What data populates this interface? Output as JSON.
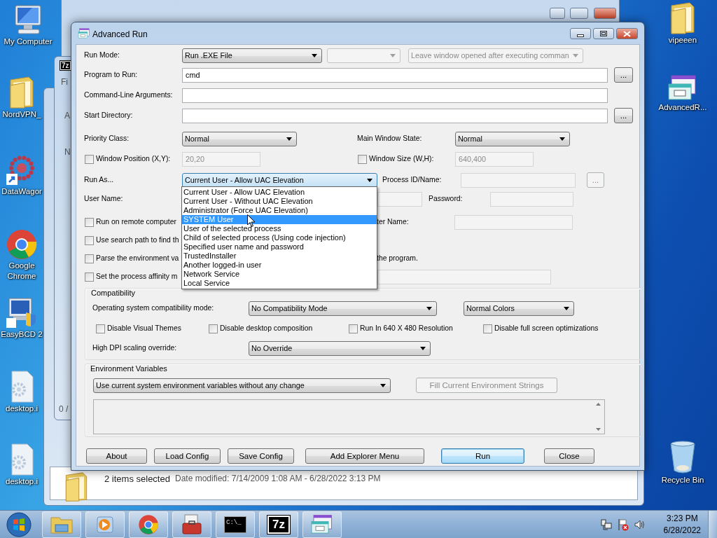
{
  "desktop_icons_left": [
    {
      "kind": "computer",
      "label": "My Computer"
    },
    {
      "kind": "folder",
      "label": "NordVPN_"
    },
    {
      "kind": "dots",
      "label": "DataWagor"
    },
    {
      "kind": "chrome",
      "label": "Google Chrome"
    },
    {
      "kind": "easybcd",
      "label": "EasyBCD 2"
    },
    {
      "kind": "gearfile",
      "label": "desktop.i"
    },
    {
      "kind": "gearfile",
      "label": "desktop.i"
    }
  ],
  "desktop_icons_right": [
    {
      "kind": "folder",
      "label": "vipeeen"
    },
    {
      "kind": "appwin",
      "label": "AdvancedR..."
    },
    {
      "kind": "recycle",
      "label": "Recycle Bin"
    }
  ],
  "back_window_7z": {
    "icon_text": "7z",
    "texts": [
      "Fi",
      "A",
      "N",
      "0 /"
    ]
  },
  "explorer_window": {
    "selection": "2 items selected",
    "date_modified": "Date modified: 7/14/2009 1:08 AM - 6/28/2022 3:13 PM"
  },
  "dialog": {
    "title": "Advanced Run",
    "rows": [
      [
        {
          "kind": "label",
          "text": "Run Mode:"
        },
        {
          "kind": "combo",
          "value": "Run .EXE File",
          "disabled": false,
          "focused": false
        },
        {
          "kind": "combo",
          "disabled": true,
          "focused": false
        },
        {
          "kind": "combo",
          "value": "Leave window opened after executing comman",
          "disabled": true,
          "focused": false
        }
      ],
      [
        {
          "kind": "label",
          "text": "Program to Run:"
        },
        {
          "kind": "input",
          "value": "cmd",
          "disabled": false
        },
        {
          "kind": "button",
          "text": "...",
          "disabled": false
        }
      ],
      [
        {
          "kind": "label",
          "text": "Command-Line Arguments:"
        },
        {
          "kind": "input",
          "disabled": false
        }
      ],
      [
        {
          "kind": "label",
          "text": "Start Directory:"
        },
        {
          "kind": "input",
          "disabled": false
        },
        {
          "kind": "button",
          "text": "...",
          "disabled": false
        }
      ],
      [
        {
          "kind": "label",
          "text": "Priority Class:"
        },
        {
          "kind": "combo",
          "value": "Normal",
          "disabled": false,
          "focused": false
        },
        {
          "kind": "label",
          "text": "Main Window State:"
        },
        {
          "kind": "combo",
          "value": "Normal",
          "disabled": false,
          "focused": false
        }
      ],
      [
        {
          "kind": "check",
          "text": "Window Position (X,Y):",
          "checked": false
        },
        {
          "kind": "input",
          "value": "20,20",
          "disabled": true
        },
        {
          "kind": "check",
          "text": "Window Size (W,H):",
          "checked": false
        },
        {
          "kind": "input",
          "value": "640,400",
          "disabled": true
        }
      ],
      [
        {
          "kind": "label",
          "text": "Run As..."
        },
        {
          "kind": "combo",
          "value": "Current User - Allow UAC Elevation",
          "disabled": false,
          "focused": true
        },
        {
          "kind": "label",
          "text": "Process ID/Name:"
        },
        {
          "kind": "input",
          "disabled": true
        },
        {
          "kind": "button",
          "text": "...",
          "disabled": true
        }
      ],
      [
        {
          "kind": "label",
          "text": "User Name:"
        },
        {
          "kind": "input",
          "disabled": true
        },
        {
          "kind": "label",
          "text": "Password:"
        },
        {
          "kind": "input",
          "disabled": true
        }
      ],
      [
        {
          "kind": "check",
          "text": "Run on remote computer",
          "checked": false
        },
        {
          "kind": "label",
          "text": "ter Name:"
        },
        {
          "kind": "input",
          "disabled": true
        }
      ],
      [
        {
          "kind": "check",
          "text": "Use search path to find th",
          "checked": false
        }
      ],
      [
        {
          "kind": "check",
          "text": "Parse the environment va",
          "checked": false
        },
        {
          "kind": "label",
          "text": "the program."
        }
      ],
      [
        {
          "kind": "check",
          "text": "Set the process affinity m",
          "checked": false
        },
        {
          "kind": "input",
          "disabled": true
        }
      ]
    ],
    "run_as_list": [
      {
        "label": "Current User - Allow UAC Elevation",
        "selected": false
      },
      {
        "label": "Current User - Without UAC Elevation",
        "selected": false
      },
      {
        "label": "Administrator (Force UAC Elevation)",
        "selected": false
      },
      {
        "label": "SYSTEM User",
        "selected": true
      },
      {
        "label": "User of the selected process",
        "selected": false
      },
      {
        "label": "Child of selected process (Using code injection)",
        "selected": false
      },
      {
        "label": "Specified user name and password",
        "selected": false
      },
      {
        "label": "TrustedInstaller",
        "selected": false
      },
      {
        "label": "Another logged-in user",
        "selected": false
      },
      {
        "label": "Network Service",
        "selected": false
      },
      {
        "label": "Local Service",
        "selected": false
      }
    ],
    "compatibility": {
      "legend": "Compatibility",
      "rows": [
        [
          {
            "kind": "label",
            "text": "Operating system compatibility mode:"
          },
          {
            "kind": "combo",
            "value": "No Compatibility Mode",
            "disabled": false,
            "focused": false
          },
          {
            "kind": "combo",
            "value": "Normal Colors",
            "disabled": false,
            "focused": false
          }
        ],
        [
          {
            "kind": "check",
            "text": "Disable Visual Themes",
            "checked": false
          },
          {
            "kind": "check",
            "text": "Disable desktop composition",
            "checked": false
          },
          {
            "kind": "check",
            "text": "Run In 640 X 480 Resolution",
            "checked": false
          },
          {
            "kind": "check",
            "text": "Disable full screen optimizations",
            "checked": false
          }
        ],
        [
          {
            "kind": "label",
            "text": "High DPI scaling override:"
          },
          {
            "kind": "combo",
            "value": "No Override",
            "disabled": false,
            "focused": false
          }
        ]
      ]
    },
    "environment": {
      "legend": "Environment Variables",
      "rows": [
        [
          {
            "kind": "combo",
            "value": "Use current system environment variables without any change",
            "disabled": false,
            "focused": false
          },
          {
            "kind": "button",
            "text": "Fill Current Environment Strings",
            "disabled": true
          }
        ],
        [
          {
            "kind": "textarea"
          }
        ]
      ]
    },
    "buttons": [
      {
        "label": "About",
        "default": false
      },
      {
        "label": "Load Config",
        "default": false
      },
      {
        "label": "Save Config",
        "default": false
      },
      {
        "label": "Add Explorer Menu",
        "default": false
      },
      {
        "label": "Run",
        "default": true
      },
      {
        "label": "Close",
        "default": false
      }
    ]
  },
  "taskbar": {
    "items": [
      {
        "kind": "explorer"
      },
      {
        "kind": "media"
      },
      {
        "kind": "chrome"
      },
      {
        "kind": "toolbox"
      },
      {
        "kind": "cmd",
        "text": "C:\\_"
      },
      {
        "kind": "sevenzip",
        "text": "7z"
      },
      {
        "kind": "appwin"
      }
    ],
    "time": "3:23 PM",
    "date": "6/28/2022"
  }
}
